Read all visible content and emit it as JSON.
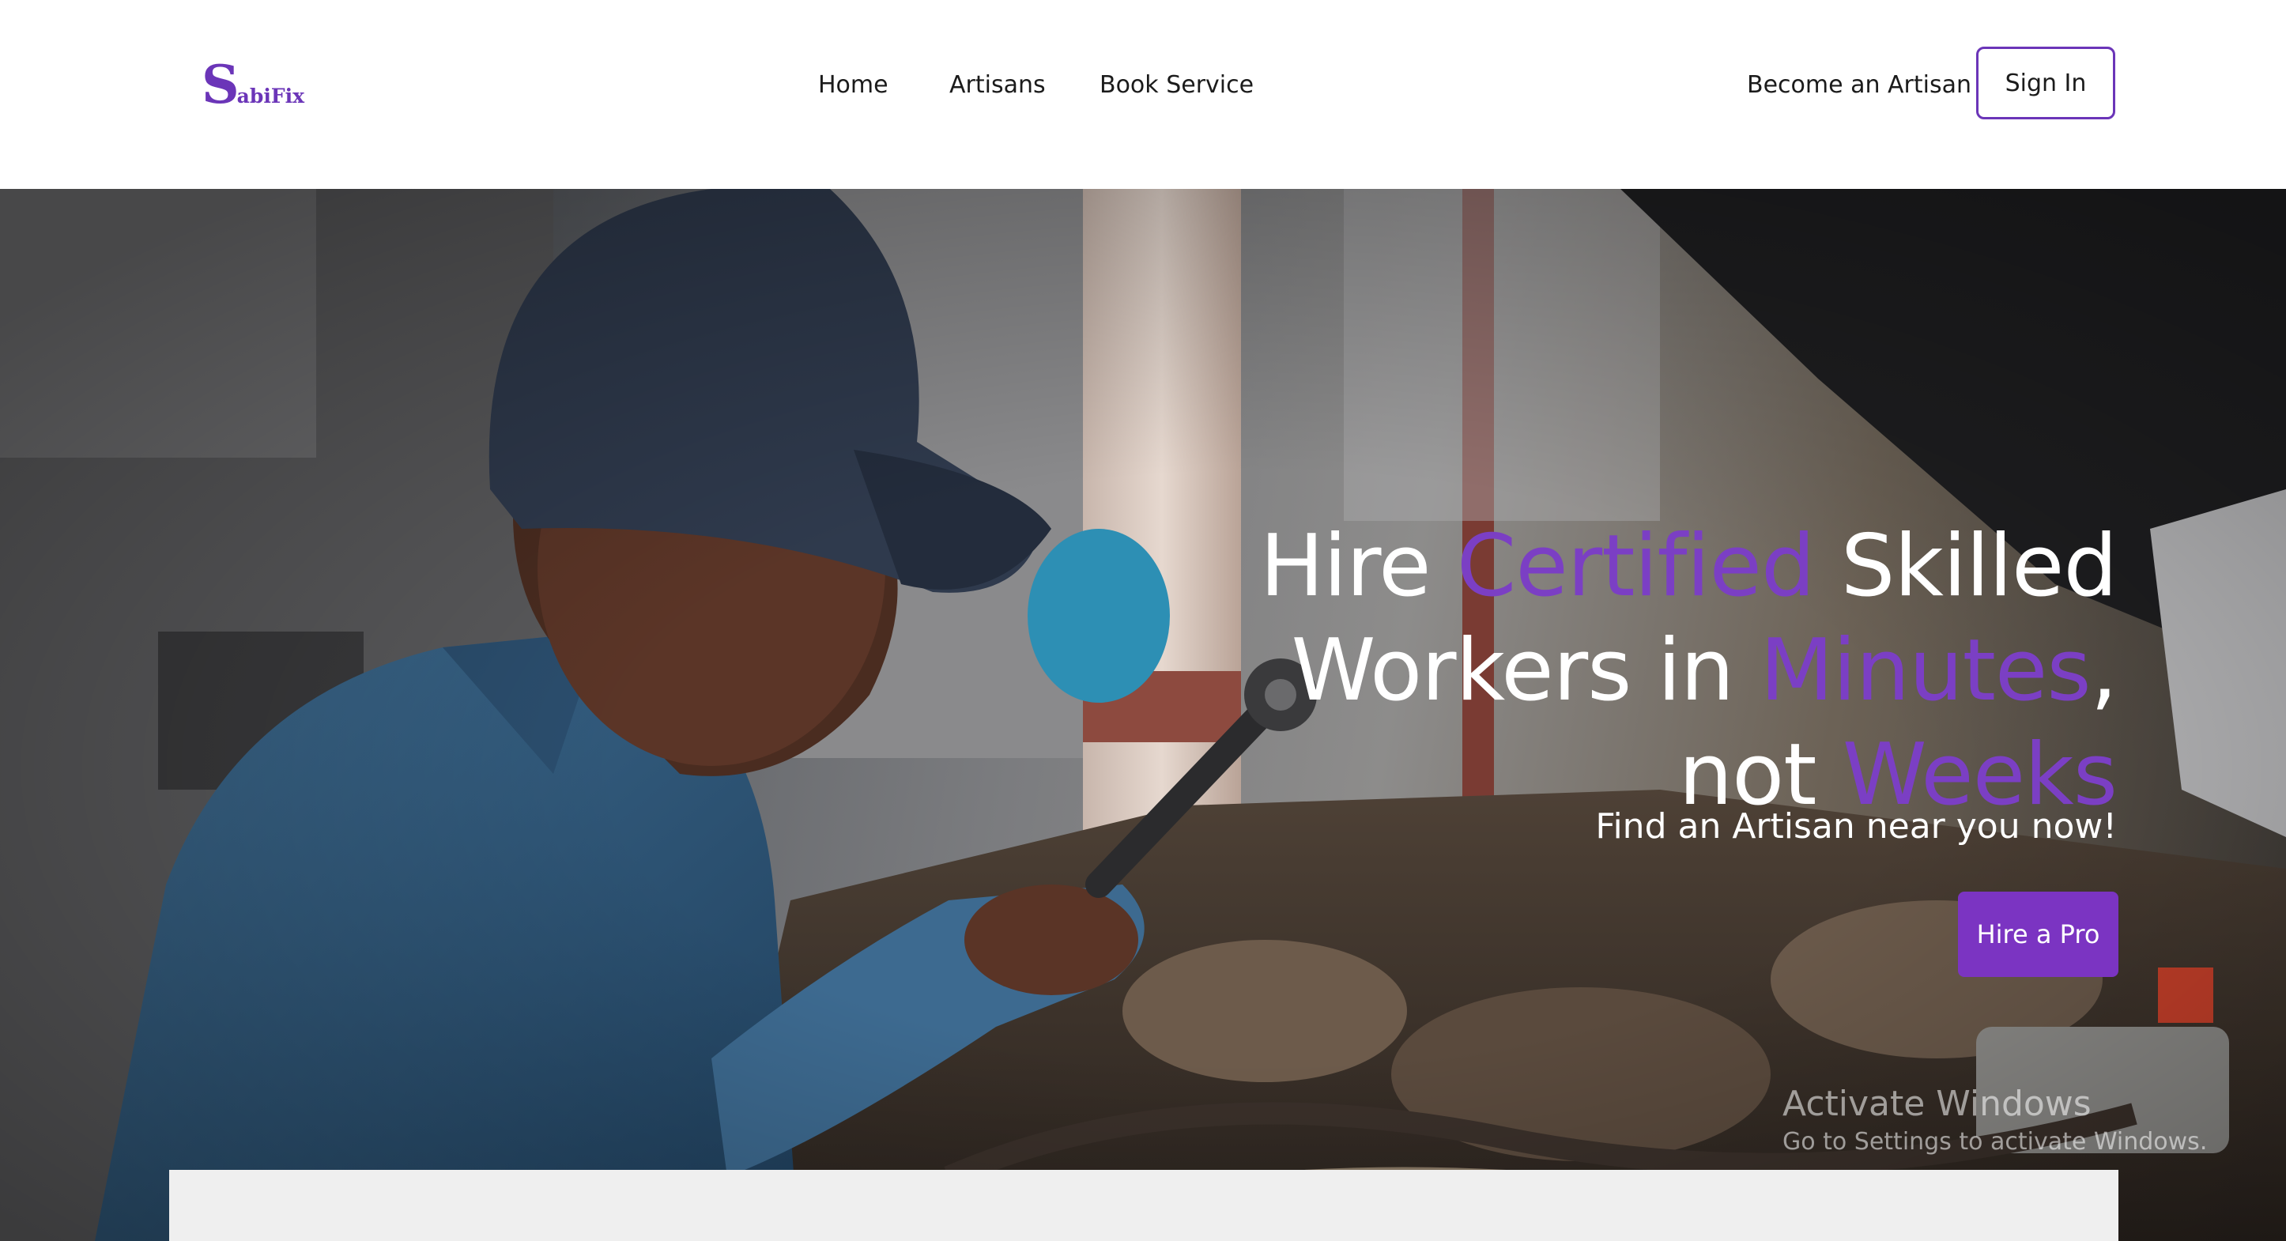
{
  "brand": {
    "logo_initial": "S",
    "logo_rest": "abiFix"
  },
  "nav": {
    "home": "Home",
    "artisans": "Artisans",
    "book_service": "Book Service"
  },
  "header_actions": {
    "become_artisan": "Become an Artisan",
    "sign_in": "Sign In"
  },
  "hero": {
    "title_part1": "Hire ",
    "title_accent1": "Certified",
    "title_part2": " Skilled Workers in ",
    "title_accent2": "Minutes",
    "title_part3": ", not ",
    "title_accent3": "Weeks",
    "subtitle": "Find an Artisan near you now!",
    "cta": "Hire a Pro"
  },
  "watermark": {
    "title": "Activate Windows",
    "subtitle": "Go to Settings to activate Windows."
  },
  "colors": {
    "brand_purple": "#6b35b8",
    "accent_purple": "#7b3fc4",
    "button_purple": "#7b34c2"
  }
}
